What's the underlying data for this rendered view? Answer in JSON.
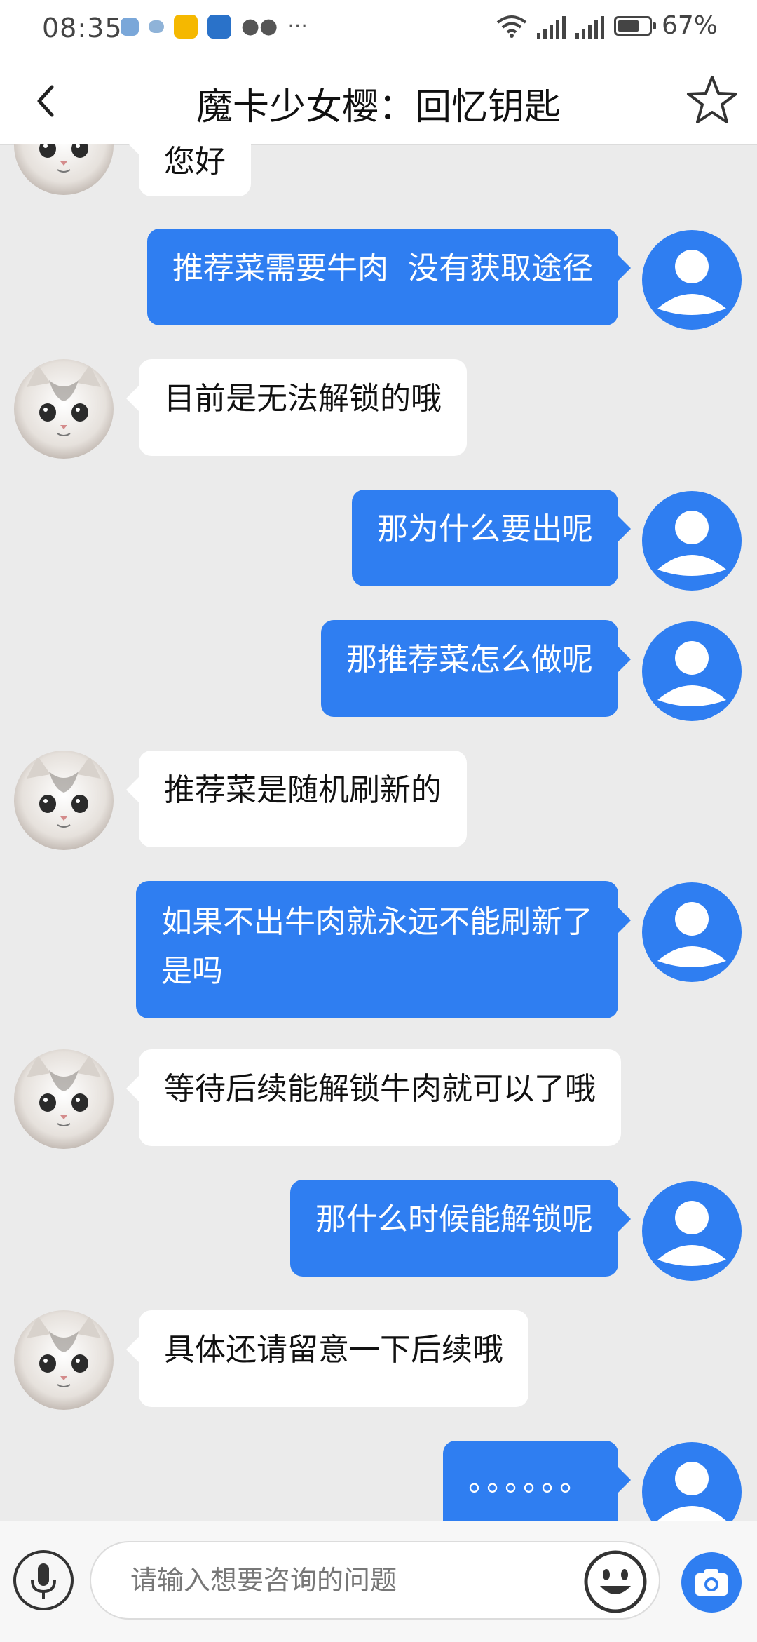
{
  "status_bar": {
    "time": "08:35",
    "battery": "67%"
  },
  "header": {
    "title": "魔卡少女樱：回忆钥匙"
  },
  "messages": [
    {
      "from": "cs",
      "text": "您好"
    },
    {
      "from": "me",
      "text": "推荐菜需要牛肉  没有获取途径"
    },
    {
      "from": "cs",
      "text": "目前是无法解锁的哦"
    },
    {
      "from": "me",
      "text": "那为什么要出呢"
    },
    {
      "from": "me",
      "text": "那推荐菜怎么做呢"
    },
    {
      "from": "cs",
      "text": "推荐菜是随机刷新的"
    },
    {
      "from": "me",
      "text": "如果不出牛肉就永远不能刷新了\n是吗"
    },
    {
      "from": "cs",
      "text": "等待后续能解锁牛肉就可以了哦"
    },
    {
      "from": "me",
      "text": "那什么时候能解锁呢"
    },
    {
      "from": "cs",
      "text": "具体还请留意一下后续哦"
    },
    {
      "from": "me",
      "text": "。。。。。。"
    }
  ],
  "input": {
    "placeholder": "请输入想要咨询的问题"
  },
  "colors": {
    "accent": "#2f7ef1",
    "background": "#ebebeb",
    "bubble_cs": "#ffffff"
  },
  "icons": [
    "back-icon",
    "star-icon",
    "mic-icon",
    "emoji-icon",
    "camera-icon",
    "cat-avatar",
    "user-avatar"
  ]
}
